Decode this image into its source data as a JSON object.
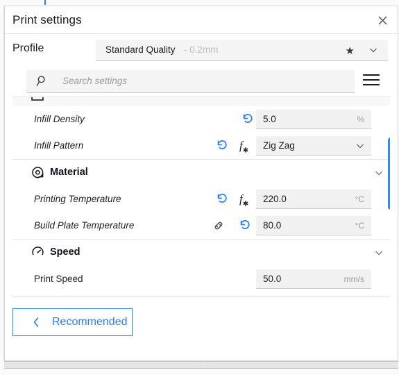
{
  "window": {
    "title": "Print settings",
    "close_icon": "close-icon"
  },
  "profile": {
    "label": "Profile",
    "name": "Standard Quality",
    "sub": "- 0.2mm",
    "star_icon": "star-filled-icon",
    "chevron_icon": "chevron-down-icon"
  },
  "search": {
    "placeholder": "Search settings",
    "icon": "search-icon",
    "menu_icon": "hamburger-menu-icon"
  },
  "settings": {
    "rows": [
      {
        "label": "Infill Density",
        "italic": true,
        "value": "5.0",
        "unit": "%",
        "type": "number",
        "revert": true,
        "fx": false,
        "link": false
      },
      {
        "label": "Infill Pattern",
        "italic": true,
        "value": "Zig Zag",
        "unit": "",
        "type": "dropdown",
        "revert": true,
        "fx": true,
        "link": false
      }
    ],
    "categories": [
      {
        "title": "Material",
        "icon": "filament-spool-icon",
        "chevron": "chevron-down-icon",
        "rows": [
          {
            "label": "Printing Temperature",
            "italic": true,
            "value": "220.0",
            "unit": "°C",
            "type": "number",
            "revert": true,
            "fx": true,
            "link": false
          },
          {
            "label": "Build Plate Temperature",
            "italic": true,
            "value": "80.0",
            "unit": "°C",
            "type": "number",
            "revert": true,
            "fx": false,
            "link": true
          }
        ]
      },
      {
        "title": "Speed",
        "icon": "speedometer-icon",
        "chevron": "chevron-down-icon",
        "rows": [
          {
            "label": "Print Speed",
            "italic": false,
            "value": "50.0",
            "unit": "mm/s",
            "type": "number",
            "revert": false,
            "fx": false,
            "link": false
          }
        ]
      }
    ]
  },
  "footer": {
    "recommended_label": "Recommended",
    "back_icon": "chevron-left-icon"
  },
  "grip": {
    "dots": "· · ·"
  },
  "colors": {
    "accent_blue": "#2b7cf0",
    "scrollbar_blue": "#3a86f5",
    "field_gray": "#f1f1f1",
    "muted_text": "#9a9a9a"
  }
}
